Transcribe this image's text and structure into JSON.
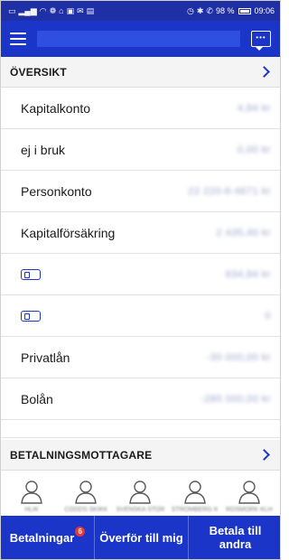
{
  "status_bar": {
    "left_icons": [
      "sim-icon",
      "signal-icon",
      "wifi-icon",
      "notification-icon",
      "app-icon",
      "image-icon",
      "mail-icon",
      "message-icon"
    ],
    "battery": "98 %",
    "time": "09:06"
  },
  "app_bar": {
    "menu_icon": "hamburger-icon",
    "chat_icon": "chat-icon"
  },
  "overview": {
    "title": "ÖVERSIKT",
    "accounts": [
      {
        "name": "Kapitalkonto",
        "value": "4,84 kr"
      },
      {
        "name": "ej i bruk",
        "value": "0,00 kr"
      },
      {
        "name": "Personkonto",
        "value": "22 220-6-4671 kr"
      },
      {
        "name": "Kapitalförsäkring",
        "value": "2 435,40 kr"
      },
      {
        "name": "",
        "value": "634,84 kr",
        "icon": "card-icon"
      },
      {
        "name": "",
        "value": "0",
        "icon": "card-icon"
      },
      {
        "name": "Privatlån",
        "value": "-30 000,00 kr"
      },
      {
        "name": "Bolån",
        "value": "-285 000,00 kr"
      }
    ]
  },
  "recipients": {
    "title": "BETALNINGSMOTTAGARE",
    "items": [
      {
        "name": "HLIK"
      },
      {
        "name": "CODDS SKIKK"
      },
      {
        "name": "SVENSKA STOR"
      },
      {
        "name": "STROMBERG K"
      },
      {
        "name": "ROSMORK KLH"
      }
    ]
  },
  "bottom_tabs": [
    {
      "label": "Betalningar",
      "badge": "6"
    },
    {
      "label": "Överför till mig"
    },
    {
      "label_line1": "Betala till",
      "label_line2": "andra"
    }
  ],
  "colors": {
    "brand_blue": "#1a35c8",
    "status_bar": "#1f2fa5",
    "badge_red": "#e53935"
  }
}
